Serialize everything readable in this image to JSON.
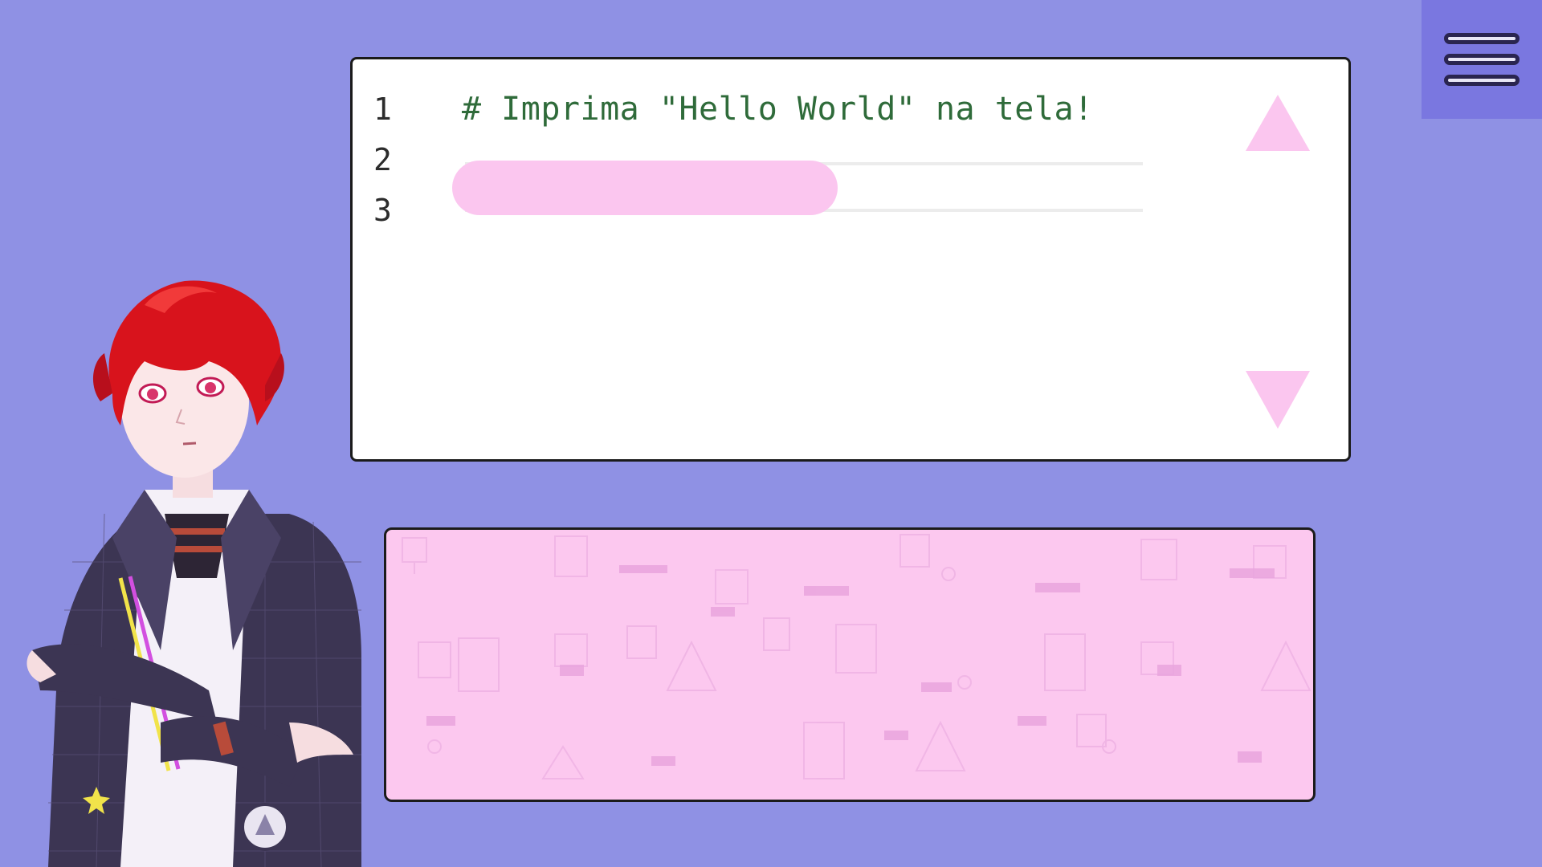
{
  "menu": {
    "icon": "hamburger-menu-icon"
  },
  "editor": {
    "lines": [
      {
        "number": "1",
        "code": "# Imprima \"Hello World\" na tela!"
      },
      {
        "number": "2",
        "code": ""
      },
      {
        "number": "3",
        "code": ""
      }
    ],
    "scroll_up_icon": "triangle-up-icon",
    "scroll_down_icon": "triangle-down-icon"
  },
  "answer_panel": {
    "text": ""
  },
  "colors": {
    "background": "#8f91e4",
    "menu_bg": "#7a77e0",
    "accent_pink": "#fbc6ef",
    "code_green": "#2f6b3a",
    "panel_border": "#1b1b1b"
  },
  "character": {
    "name": ""
  }
}
